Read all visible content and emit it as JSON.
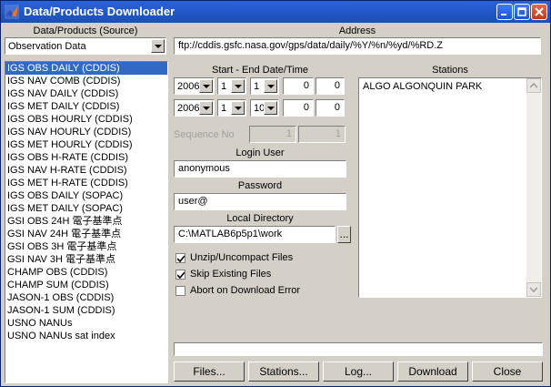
{
  "window": {
    "title": "Data/Products Downloader"
  },
  "source": {
    "label": "Data/Products (Source)",
    "selected": "Observation Data"
  },
  "address": {
    "label": "Address",
    "value": "ftp://cddis.gsfc.nasa.gov/gps/data/daily/%Y/%n/%yd/%RD.Z"
  },
  "products": [
    "IGS OBS DAILY (CDDIS)",
    "IGS NAV COMB  (CDDIS)",
    "IGS NAV DAILY (CDDIS)",
    "IGS MET DAILY (CDDIS)",
    "IGS OBS HOURLY (CDDIS)",
    "IGS NAV HOURLY (CDDIS)",
    "IGS MET HOURLY (CDDIS)",
    "IGS OBS H-RATE (CDDIS)",
    "IGS NAV H-RATE (CDDIS)",
    "IGS MET H-RATE (CDDIS)",
    "IGS OBS DAILY (SOPAC)",
    "IGS MET DAILY (SOPAC)",
    "GSI OBS 24H 電子基準点",
    "GSI NAV 24H 電子基準点",
    "GSI OBS  3H 電子基準点",
    "GSI NAV  3H 電子基準点",
    "CHAMP OBS (CDDIS)",
    "CHAMP SUM (CDDIS)",
    "JASON-1 OBS (CDDIS)",
    "JASON-1 SUM (CDDIS)",
    "USNO NANUs",
    "USNO NANUs sat index"
  ],
  "dates": {
    "label": "Start - End Date/Time",
    "start": {
      "year": "2006",
      "month": "1",
      "day": "1",
      "hour": "0",
      "minute": "0"
    },
    "end": {
      "year": "2006",
      "month": "1",
      "day": "10",
      "hour": "0",
      "minute": "0"
    }
  },
  "sequence": {
    "label": "Sequence No",
    "from": "1",
    "to": "1"
  },
  "login": {
    "label": "Login User",
    "value": "anonymous"
  },
  "password": {
    "label": "Password",
    "value": "user@"
  },
  "local_dir": {
    "label": "Local Directory",
    "value": "C:\\MATLAB6p5p1\\work",
    "browse": "..."
  },
  "options": {
    "unzip": {
      "label": "Unzip/Uncompact Files",
      "checked": true
    },
    "skip": {
      "label": "Skip Existing Files",
      "checked": true
    },
    "abort": {
      "label": "Abort on Download Error",
      "checked": false
    }
  },
  "stations": {
    "label": "Stations",
    "items": [
      "ALGO ALGONQUIN PARK"
    ]
  },
  "status": {
    "text": ""
  },
  "buttons": {
    "files": "Files...",
    "stations": "Stations...",
    "log": "Log...",
    "download": "Download",
    "close": "Close"
  }
}
